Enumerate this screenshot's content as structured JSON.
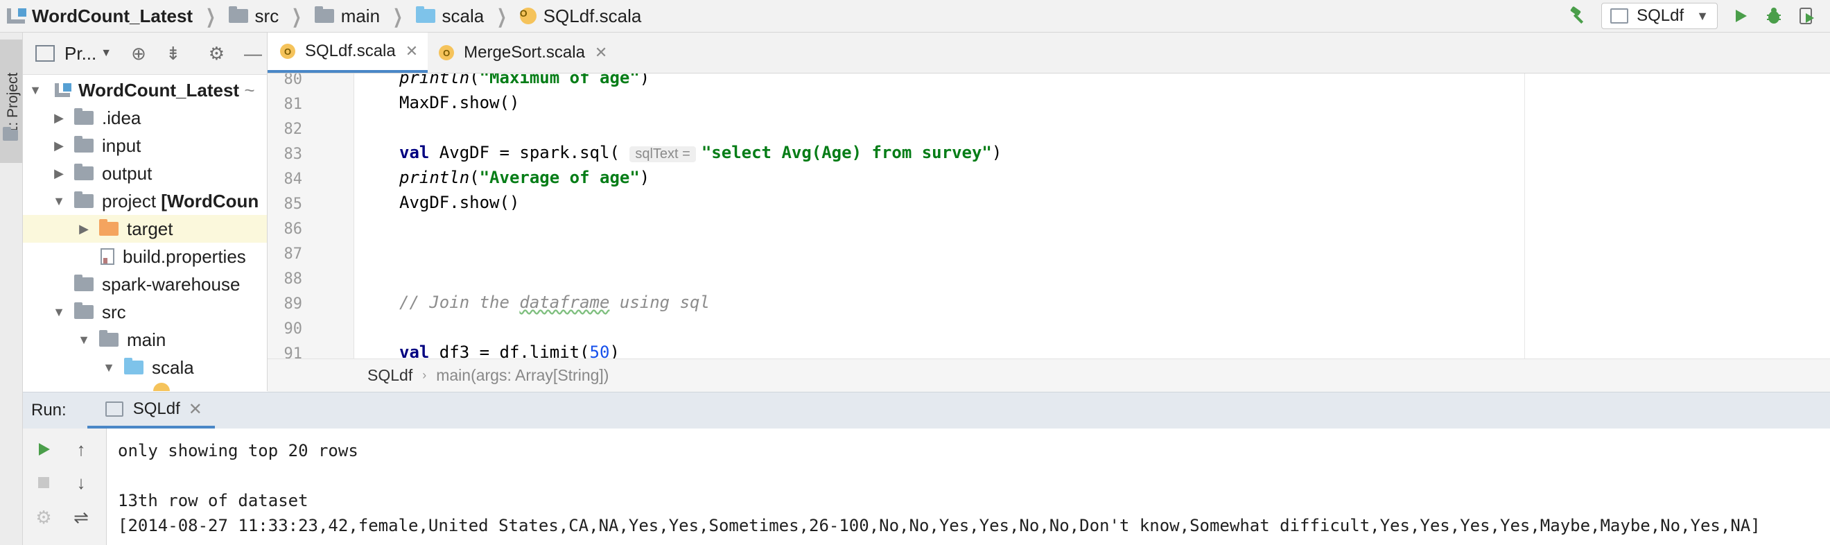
{
  "navbar": {
    "project": "WordCount_Latest",
    "crumbs": [
      "src",
      "main",
      "scala",
      "SQLdf.scala"
    ],
    "run_config": "SQLdf"
  },
  "left_stripe": {
    "label": "1: Project"
  },
  "project_panel": {
    "title": "Pr...",
    "tree": [
      {
        "label": "WordCount_Latest",
        "suffix": "~"
      },
      {
        "label": ".idea"
      },
      {
        "label": "input"
      },
      {
        "label": "output"
      },
      {
        "label": "project",
        "suffix": "[WordCoun"
      },
      {
        "label": "target"
      },
      {
        "label": "build.properties"
      },
      {
        "label": "spark-warehouse"
      },
      {
        "label": "src"
      },
      {
        "label": "main"
      },
      {
        "label": "scala"
      }
    ]
  },
  "tabs": [
    {
      "label": "SQLdf.scala",
      "active": true
    },
    {
      "label": "MergeSort.scala",
      "active": false
    }
  ],
  "editor": {
    "lines": [
      {
        "n": "80",
        "text": "println(\"Maximum of age\")"
      },
      {
        "n": "81",
        "text": "MaxDF.show()"
      },
      {
        "n": "82",
        "text": ""
      },
      {
        "n": "83",
        "text": "val AvgDF = spark.sql( sqlText = \"select Avg(Age) from survey\")"
      },
      {
        "n": "84",
        "text": "println(\"Average of age\")"
      },
      {
        "n": "85",
        "text": "AvgDF.show()"
      },
      {
        "n": "86",
        "text": ""
      },
      {
        "n": "87",
        "text": ""
      },
      {
        "n": "88",
        "text": ""
      },
      {
        "n": "89",
        "text": "// Join the dataframe using sql"
      },
      {
        "n": "90",
        "text": ""
      },
      {
        "n": "91",
        "text": "val df3 = df.limit(50)"
      }
    ],
    "tokens": {
      "l80_fn": "println",
      "l80_str": "\"Maximum of age\"",
      "l81": "MaxDF.show()",
      "l83_kw": "val",
      "l83_a": " AvgDF = spark.sql(",
      "l83_hint": "sqlText =",
      "l83_str": "\"select Avg(Age) from survey\"",
      "l84_fn": "println",
      "l84_str": "\"Average of age\"",
      "l85": "AvgDF.show()",
      "l89_a": "// Join the ",
      "l89_b": "dataframe",
      "l89_c": " using sql",
      "l91_kw": "val",
      "l91_a": " df3 = df.limit(",
      "l91_num": "50",
      "l91_b": ")"
    }
  },
  "code_breadcrumb": {
    "object": "SQLdf",
    "method": "main(args: Array[String])"
  },
  "run_panel": {
    "label": "Run:",
    "tab": "SQLdf",
    "console": [
      "only showing top 20 rows",
      "",
      "13th row of dataset",
      "[2014-08-27 11:33:23,42,female,United States,CA,NA,Yes,Yes,Sometimes,26-100,No,No,Yes,Yes,No,No,Don't know,Somewhat difficult,Yes,Yes,Yes,Yes,Maybe,Maybe,No,Yes,NA]"
    ]
  },
  "colors": {
    "accent": "#4a87c7",
    "run_green": "#4a9e4a",
    "string_green": "#067d17",
    "keyword_navy": "#000080"
  }
}
